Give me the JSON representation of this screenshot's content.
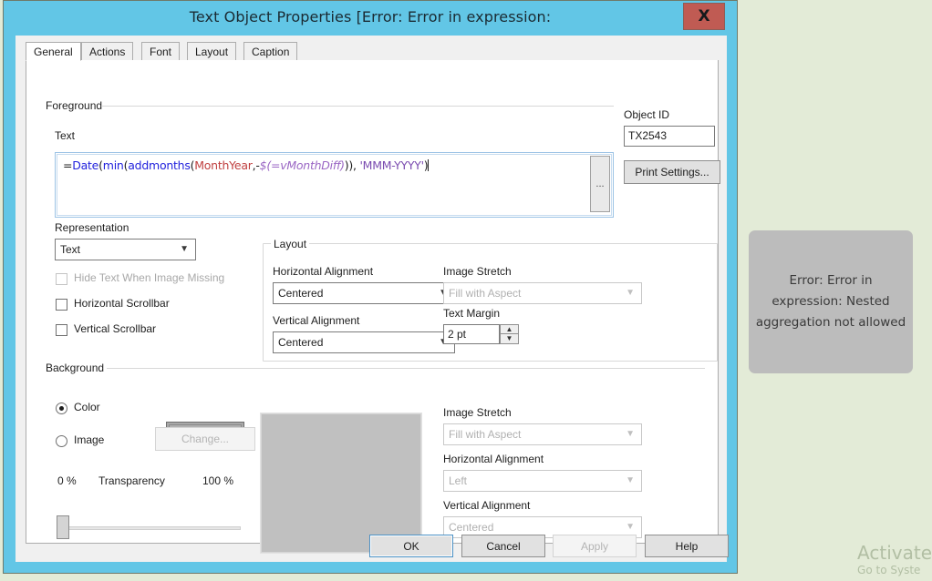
{
  "window": {
    "title": "Text Object Properties [Error: Error in expression:",
    "close_label": "X"
  },
  "tabs": [
    {
      "label": "General",
      "active": true
    },
    {
      "label": "Actions",
      "active": false
    },
    {
      "label": "Font",
      "active": false
    },
    {
      "label": "Layout",
      "active": false
    },
    {
      "label": "Caption",
      "active": false
    }
  ],
  "foreground": {
    "group_label": "Foreground",
    "text_label": "Text",
    "expression": {
      "full": "=Date(min(addmonths(MonthYear,-$(=vMonthDiff))), 'MMM-YYYY')",
      "tokens": [
        {
          "t": "=",
          "c": "op"
        },
        {
          "t": "Date",
          "c": "fn"
        },
        {
          "t": "(",
          "c": "op"
        },
        {
          "t": "min",
          "c": "fn"
        },
        {
          "t": "(",
          "c": "op"
        },
        {
          "t": "addmonths",
          "c": "fn"
        },
        {
          "t": "(",
          "c": "op"
        },
        {
          "t": "MonthYear",
          "c": "fld"
        },
        {
          "t": ",-",
          "c": "op"
        },
        {
          "t": "$(=vMonthDiff)",
          "c": "var"
        },
        {
          "t": ")), ",
          "c": "op"
        },
        {
          "t": "'MMM-YYYY'",
          "c": "str"
        },
        {
          "t": ")",
          "c": "op"
        }
      ]
    },
    "ellipsis_button": "..."
  },
  "object_id": {
    "label": "Object ID",
    "value": "TX2543",
    "print_settings_button": "Print Settings..."
  },
  "representation": {
    "label": "Representation",
    "value": "Text",
    "options": [
      "Text"
    ],
    "checkboxes": [
      {
        "label": "Hide Text When Image Missing",
        "checked": false,
        "disabled": true
      },
      {
        "label": "Horizontal Scrollbar",
        "checked": false,
        "disabled": false
      },
      {
        "label": "Vertical Scrollbar",
        "checked": false,
        "disabled": false
      }
    ]
  },
  "layout_group": {
    "group_label": "Layout",
    "horizontal_alignment_label": "Horizontal Alignment",
    "horizontal_alignment_value": "Centered",
    "vertical_alignment_label": "Vertical Alignment",
    "vertical_alignment_value": "Centered",
    "image_stretch_label": "Image Stretch",
    "image_stretch_value": "Fill with Aspect",
    "text_margin_label": "Text Margin",
    "text_margin_value": "2 pt"
  },
  "background": {
    "group_label": "Background",
    "color_radio_label": "Color",
    "image_radio_label": "Image",
    "color_selected": true,
    "change_button": "Change...",
    "transparency_label": "Transparency",
    "transparency_min": "0 %",
    "transparency_max": "100 %",
    "color_swatch_hex": "#b0b0b0",
    "preview_hex": "#c0c0c0",
    "image_stretch_label": "Image Stretch",
    "image_stretch_value": "Fill with Aspect",
    "horizontal_alignment_label": "Horizontal Alignment",
    "horizontal_alignment_value": "Left",
    "vertical_alignment_label": "Vertical Alignment",
    "vertical_alignment_value": "Centered"
  },
  "buttons": {
    "ok": "OK",
    "cancel": "Cancel",
    "apply": "Apply",
    "help": "Help"
  },
  "error_tooltip": {
    "text": "Error: Error in expression: Nested aggregation not allowed",
    "background_hex": "#bcbcbc"
  },
  "watermark": {
    "line1": "Activate",
    "line2": "Go to Syste"
  },
  "colors": {
    "titlebar": "#62c6e6",
    "close_button": "#c05b53",
    "desktop": "#e3ebd7",
    "panel": "#ffffff"
  }
}
